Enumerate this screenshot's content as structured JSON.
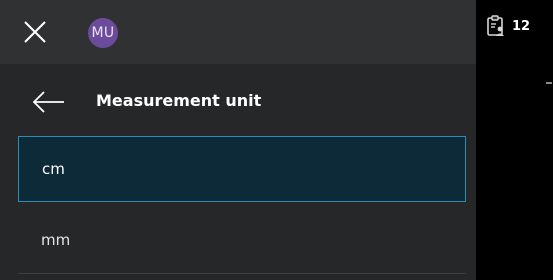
{
  "topbar": {
    "close_icon": "close-icon",
    "avatar_initials": "MU",
    "avatar_color": "#6c4b9a"
  },
  "header": {
    "back_icon": "arrow-left-icon",
    "title": "Measurement unit"
  },
  "options": [
    {
      "label": "cm",
      "selected": true
    },
    {
      "label": "mm",
      "selected": false
    }
  ],
  "side_badge": {
    "icon": "clipboard-person-icon",
    "count": "12"
  },
  "colors": {
    "selected_border": "#2b8db0",
    "selected_background": "#0d2a38",
    "panel_background": "#252729",
    "topbar_background": "#2f3133"
  }
}
